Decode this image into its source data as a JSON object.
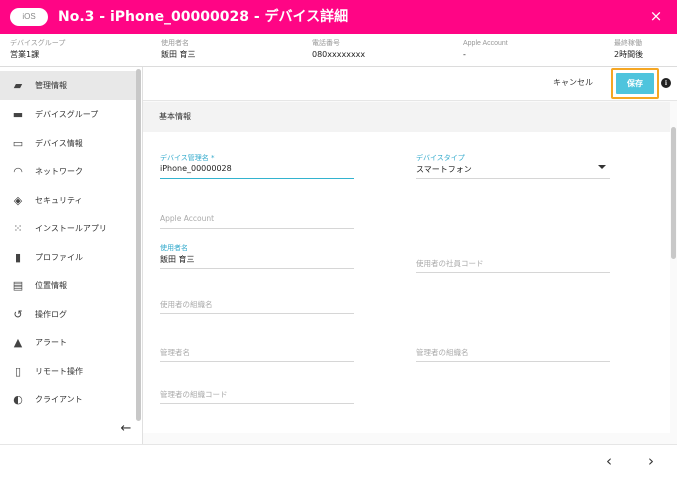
{
  "header": {
    "os_badge": "iOS",
    "title": "No.3 - iPhone_00000028 - デバイス詳細",
    "close_icon": "×",
    "color": "#ff0585"
  },
  "info": [
    {
      "label": "デバイスグループ",
      "value": "営業1課"
    },
    {
      "label": "使用者名",
      "value": "飯田 育三"
    },
    {
      "label": "電話番号",
      "value": "080xxxxxxxx"
    },
    {
      "label": "Apple Account",
      "value": "-"
    },
    {
      "label": "最終稼働",
      "value": "2時間後"
    }
  ],
  "sidebar": {
    "items": [
      {
        "label": "管理情報",
        "icon": "book-icon",
        "glyph": "▰",
        "active": true
      },
      {
        "label": "デバイスグループ",
        "icon": "folder-icon",
        "glyph": "▬",
        "active": false
      },
      {
        "label": "デバイス情報",
        "icon": "devices-icon",
        "glyph": "▭",
        "active": false
      },
      {
        "label": "ネットワーク",
        "icon": "wifi-icon",
        "glyph": "◠",
        "active": false
      },
      {
        "label": "セキュリティ",
        "icon": "shield-icon",
        "glyph": "◈",
        "active": false
      },
      {
        "label": "インストールアプリ",
        "icon": "apps-grid-icon",
        "glyph": "⁙",
        "active": false
      },
      {
        "label": "プロファイル",
        "icon": "file-icon",
        "glyph": "▮",
        "active": false
      },
      {
        "label": "位置情報",
        "icon": "map-icon",
        "glyph": "▤",
        "active": false
      },
      {
        "label": "操作ログ",
        "icon": "history-icon",
        "glyph": "↺",
        "active": false
      },
      {
        "label": "アラート",
        "icon": "warning-icon",
        "glyph": "▲",
        "active": false
      },
      {
        "label": "リモート操作",
        "icon": "remote-phone-icon",
        "glyph": "▯",
        "active": false
      },
      {
        "label": "クライアント",
        "icon": "client-icon",
        "glyph": "◐",
        "active": false
      }
    ],
    "collapse_glyph": "←"
  },
  "actions": {
    "cancel_label": "キャンセル",
    "save_label": "保存",
    "info_glyph": "i",
    "save_color": "#4ec4dd",
    "highlight_color": "#f5a623"
  },
  "section": {
    "title": "基本情報"
  },
  "form": {
    "device_admin_name": {
      "label": "デバイス管理名 *",
      "value": "iPhone_00000028"
    },
    "device_type": {
      "label": "デバイスタイプ",
      "value": "スマートフォン"
    },
    "apple_account": {
      "placeholder": "Apple Account"
    },
    "user_name": {
      "label": "使用者名",
      "value": "飯田 育三"
    },
    "user_employee_code": {
      "placeholder": "使用者の社員コード"
    },
    "user_org_name": {
      "placeholder": "使用者の組織名"
    },
    "admin_name": {
      "placeholder": "管理者名"
    },
    "admin_org_name": {
      "placeholder": "管理者の組織名"
    },
    "admin_org_code": {
      "placeholder": "管理者の組織コード"
    }
  },
  "footer": {
    "prev_glyph": "‹",
    "next_glyph": "›"
  }
}
